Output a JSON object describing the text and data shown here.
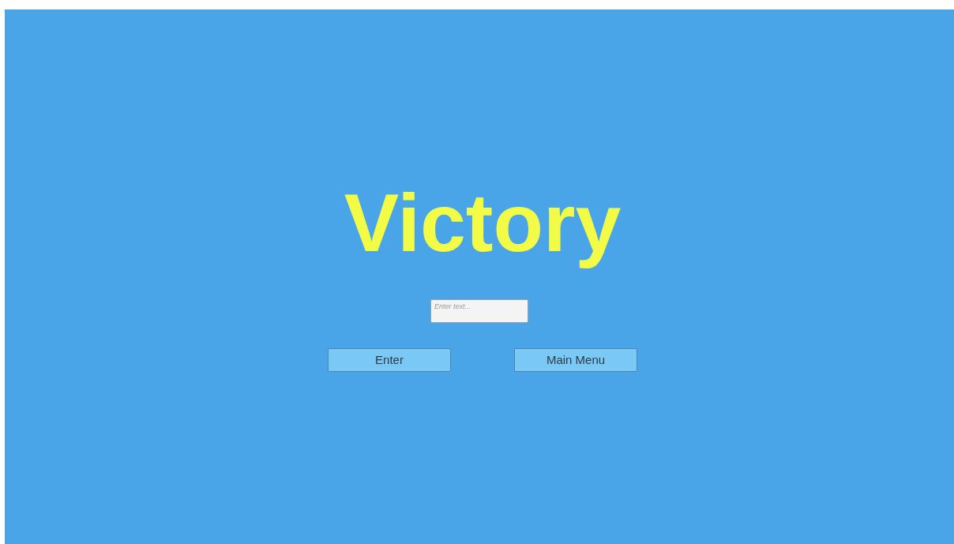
{
  "title": "Victory",
  "name_field": {
    "placeholder": "Enter text..."
  },
  "buttons": [
    {
      "label": "Enter"
    },
    {
      "label": "Main Menu"
    }
  ]
}
